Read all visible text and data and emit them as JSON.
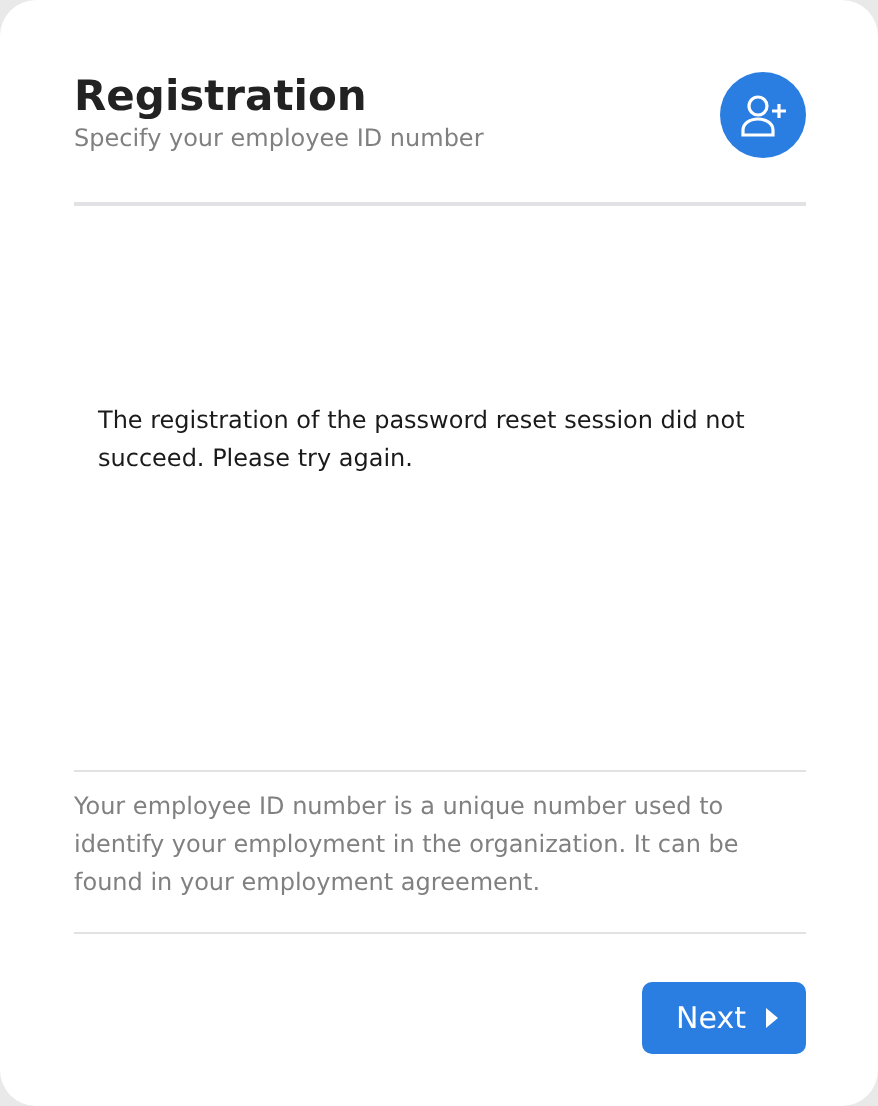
{
  "header": {
    "title": "Registration",
    "subtitle": "Specify your employee ID number"
  },
  "message": "The registration of the password reset session did not succeed. Please try again.",
  "info": "Your employee ID number is a unique number used to identify your employment in the organization. It can be found in your employment agreement.",
  "buttons": [
    {
      "label": "Next"
    }
  ]
}
